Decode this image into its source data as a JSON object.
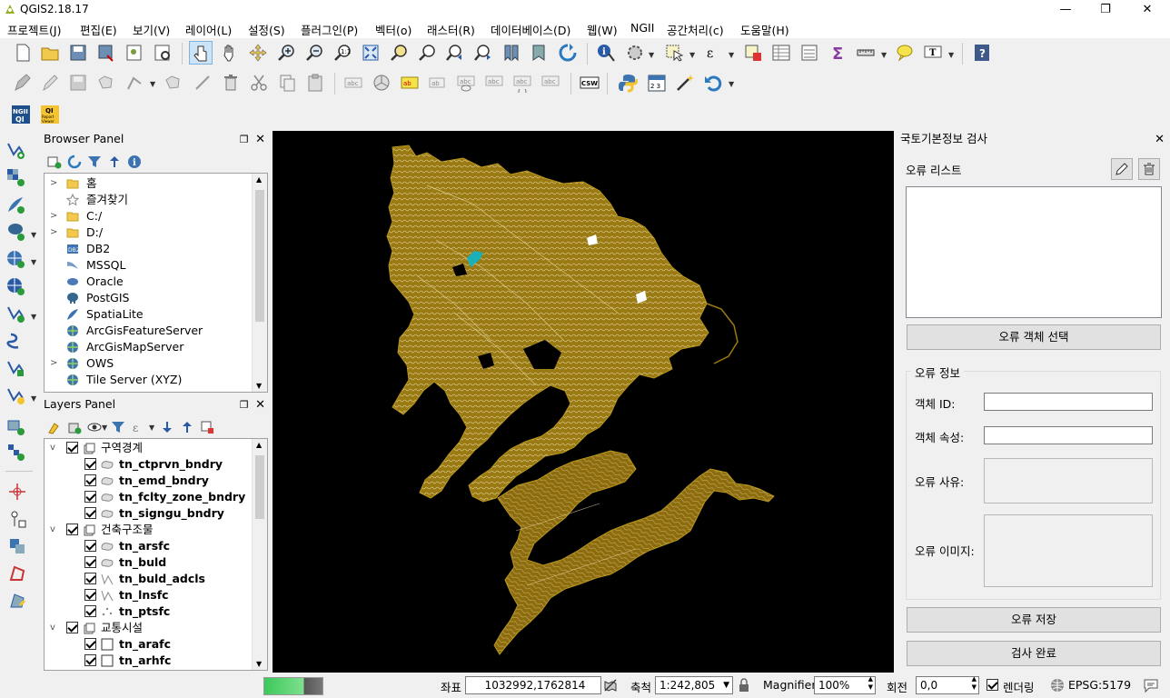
{
  "window": {
    "title": "QGIS2.18.17",
    "minimize": "—",
    "maximize": "❐",
    "close": "✕"
  },
  "menu": [
    "프로젝트(J)",
    "편집(E)",
    "보기(V)",
    "레이어(L)",
    "설정(S)",
    "플러그인(P)",
    "벡터(o)",
    "래스터(R)",
    "데이터베이스(D)",
    "웹(W)",
    "NGII",
    "공간처리(c)",
    "도움말(H)"
  ],
  "plugin_toolbar": {
    "ngii_label": "NGII QI",
    "qi_report_label": "QI Report Viewer"
  },
  "browser_panel": {
    "title": "Browser Panel",
    "items": [
      {
        "label": "홈",
        "icon": "folder-icon"
      },
      {
        "label": "즐겨찾기",
        "icon": "star-icon"
      },
      {
        "label": "C:/",
        "icon": "folder-icon"
      },
      {
        "label": "D:/",
        "icon": "folder-icon"
      },
      {
        "label": "DB2",
        "icon": "db2-icon"
      },
      {
        "label": "MSSQL",
        "icon": "mssql-icon"
      },
      {
        "label": "Oracle",
        "icon": "oracle-icon"
      },
      {
        "label": "PostGIS",
        "icon": "postgis-icon"
      },
      {
        "label": "SpatiaLite",
        "icon": "spatialite-icon"
      },
      {
        "label": "ArcGisFeatureServer",
        "icon": "globe-icon"
      },
      {
        "label": "ArcGisMapServer",
        "icon": "globe-icon"
      },
      {
        "label": "OWS",
        "icon": "globe-icon"
      },
      {
        "label": "Tile Server (XYZ)",
        "icon": "globe-icon"
      }
    ]
  },
  "layers_panel": {
    "title": "Layers Panel",
    "rows": [
      {
        "label": "구역경계",
        "level": 0,
        "group": true,
        "checked": true,
        "bold": false
      },
      {
        "label": "tn_ctprvn_bndry",
        "level": 1,
        "checked": true,
        "bold": true,
        "icon": "polygon-icon"
      },
      {
        "label": "tn_emd_bndry",
        "level": 1,
        "checked": true,
        "bold": true,
        "icon": "polygon-icon"
      },
      {
        "label": "tn_fclty_zone_bndry",
        "level": 1,
        "checked": true,
        "bold": true,
        "icon": "polygon-icon"
      },
      {
        "label": "tn_signgu_bndry",
        "level": 1,
        "checked": true,
        "bold": true,
        "icon": "polygon-icon"
      },
      {
        "label": "건축구조물",
        "level": 0,
        "group": true,
        "checked": true,
        "bold": false
      },
      {
        "label": "tn_arsfc",
        "level": 1,
        "checked": true,
        "bold": true,
        "icon": "polygon-icon"
      },
      {
        "label": "tn_buld",
        "level": 1,
        "checked": true,
        "bold": true,
        "icon": "polygon-icon"
      },
      {
        "label": "tn_buld_adcls",
        "level": 1,
        "checked": true,
        "bold": true,
        "icon": "line-icon"
      },
      {
        "label": "tn_lnsfc",
        "level": 1,
        "checked": true,
        "bold": true,
        "icon": "line-icon"
      },
      {
        "label": "tn_ptsfc",
        "level": 1,
        "checked": true,
        "bold": true,
        "icon": "point-icon"
      },
      {
        "label": "교통시설",
        "level": 0,
        "group": true,
        "checked": true,
        "bold": false
      },
      {
        "label": "tn_arafc",
        "level": 1,
        "checked": true,
        "bold": true,
        "icon": "empty-box-icon",
        "noarrow": true
      },
      {
        "label": "tn_arhfc",
        "level": 1,
        "checked": true,
        "bold": true,
        "icon": "empty-box-icon",
        "noarrow": true
      }
    ]
  },
  "inspection_panel": {
    "title": "국토기본정보 검사",
    "error_list_label": "오류 리스트",
    "select_button": "오류 객체 선택",
    "info_group": "오류 정보",
    "object_id_label": "객체 ID:",
    "object_attr_label": "객체 속성:",
    "error_reason_label": "오류 사유:",
    "error_image_label": "오류 이미지:",
    "save_button": "오류 저장",
    "complete_button": "검사 완료"
  },
  "status": {
    "coord_label": "좌표",
    "coord_value": "1032992,1762814",
    "scale_label": "축척",
    "scale_value": "1:242,805",
    "magnifier_label": "Magnifier",
    "magnifier_value": "100%",
    "rotation_label": "회전",
    "rotation_value": "0,0",
    "render_label": "렌더링",
    "render_checked": true,
    "crs": "EPSG:5179"
  },
  "colors": {
    "map_bg": "#000000",
    "contour": "#9a7a12",
    "contour_light": "#e8d9a8",
    "accent_cyan": "#1ab0b8"
  }
}
